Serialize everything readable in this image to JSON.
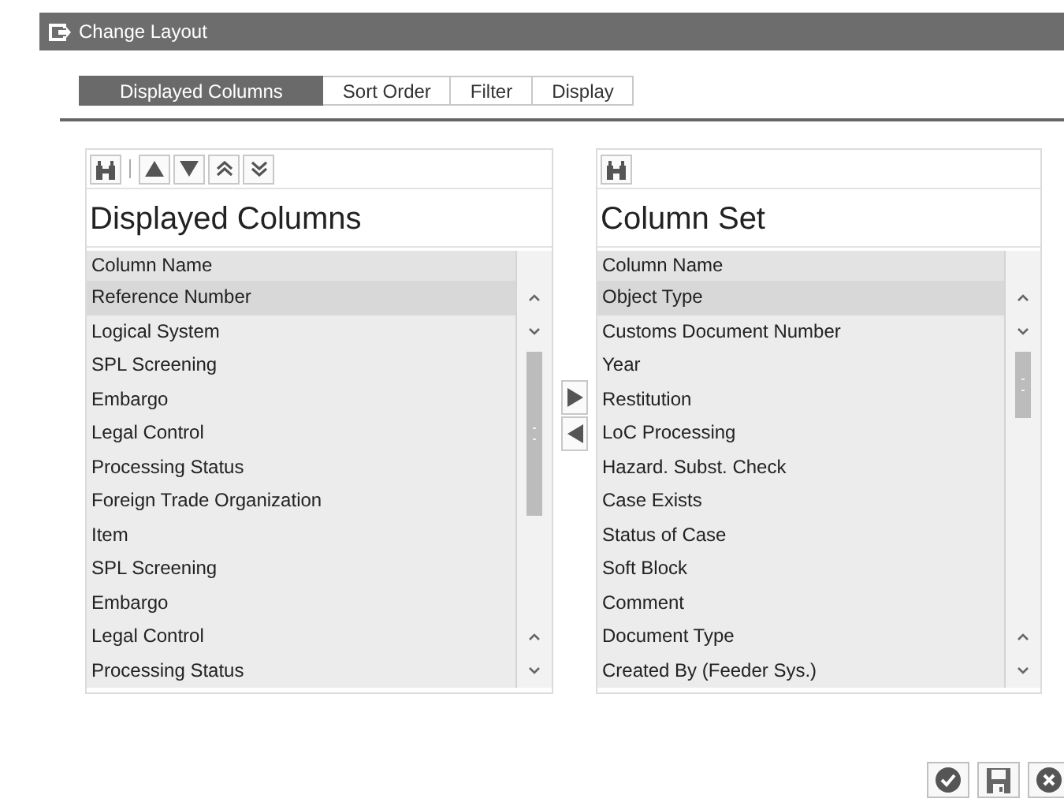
{
  "window": {
    "title": "Change Layout"
  },
  "tabs": [
    {
      "label": "Displayed Columns",
      "selected": true
    },
    {
      "label": "Sort Order",
      "selected": false
    },
    {
      "label": "Filter",
      "selected": false
    },
    {
      "label": "Display",
      "selected": false
    }
  ],
  "panels": [
    {
      "title": "Displayed Columns",
      "toolbar": [
        {
          "kind": "find"
        },
        {
          "kind": "separator"
        },
        {
          "kind": "up"
        },
        {
          "kind": "down"
        },
        {
          "kind": "top"
        },
        {
          "kind": "bottom"
        }
      ],
      "column_header": "Column Name",
      "rows": [
        {
          "text": "Reference Number",
          "selected": true
        },
        {
          "text": "Logical System",
          "selected": false
        },
        {
          "text": "SPL Screening",
          "selected": false
        },
        {
          "text": "Embargo",
          "selected": false
        },
        {
          "text": "Legal Control",
          "selected": false
        },
        {
          "text": "Processing Status",
          "selected": false
        },
        {
          "text": "Foreign Trade Organization",
          "selected": false
        },
        {
          "text": "Item",
          "selected": false
        },
        {
          "text": "SPL Screening",
          "selected": false
        },
        {
          "text": "Embargo",
          "selected": false
        },
        {
          "text": "Legal Control",
          "selected": false
        },
        {
          "text": "Processing Status",
          "selected": false
        }
      ]
    },
    {
      "title": "Column Set",
      "toolbar": [
        {
          "kind": "find"
        }
      ],
      "column_header": "Column Name",
      "rows": [
        {
          "text": "Object Type",
          "selected": true
        },
        {
          "text": "Customs Document Number",
          "selected": false
        },
        {
          "text": "Year",
          "selected": false
        },
        {
          "text": "Restitution",
          "selected": false
        },
        {
          "text": "LoC Processing",
          "selected": false
        },
        {
          "text": "Hazard. Subst. Check",
          "selected": false
        },
        {
          "text": "Case Exists",
          "selected": false
        },
        {
          "text": "Status of Case",
          "selected": false
        },
        {
          "text": "Soft Block",
          "selected": false
        },
        {
          "text": "Comment",
          "selected": false
        },
        {
          "text": "Document Type",
          "selected": false
        },
        {
          "text": "Created By (Feeder Sys.)",
          "selected": false
        }
      ]
    }
  ]
}
